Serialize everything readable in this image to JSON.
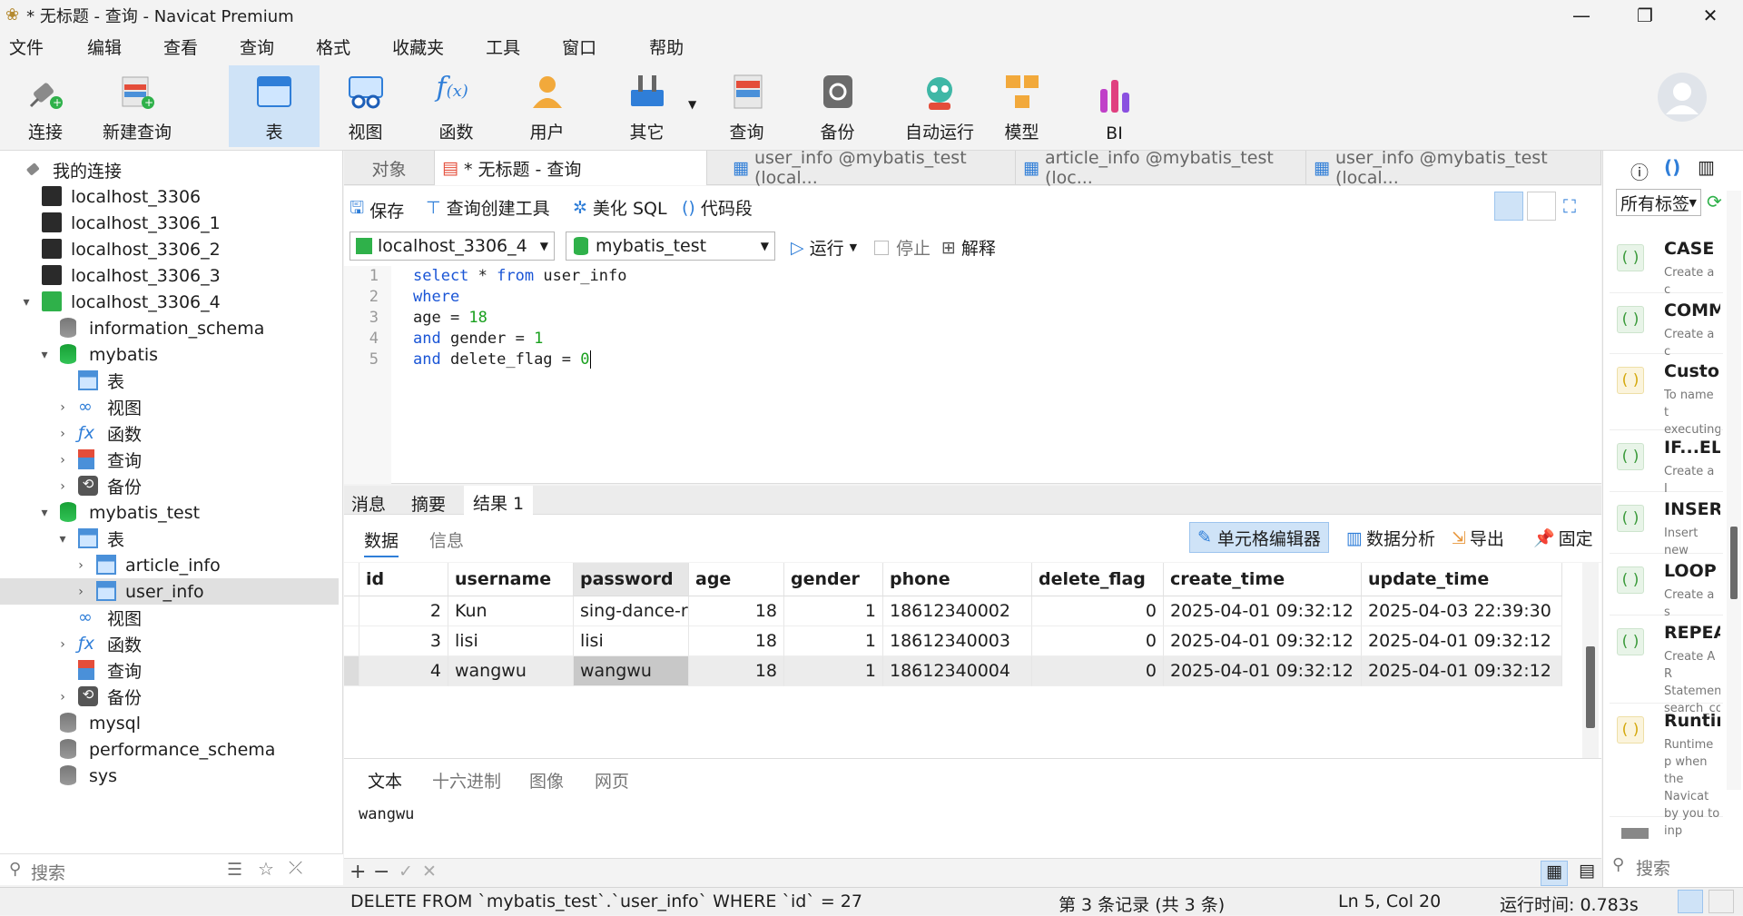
{
  "window": {
    "title": "* 无标题 - 查询 - Navicat Premium",
    "minimize": "—",
    "maximize": "❐",
    "close": "✕"
  },
  "menu": [
    "文件",
    "编辑",
    "查看",
    "查询",
    "格式",
    "收藏夹",
    "工具",
    "窗口",
    "帮助"
  ],
  "toolbar": [
    {
      "label": "连接",
      "icon": "plug-icon"
    },
    {
      "label": "新建查询",
      "icon": "new-query-icon"
    },
    {
      "label": "表",
      "icon": "table-icon",
      "active": true
    },
    {
      "label": "视图",
      "icon": "view-icon"
    },
    {
      "label": "函数",
      "icon": "function-icon"
    },
    {
      "label": "用户",
      "icon": "user-icon"
    },
    {
      "label": "其它",
      "icon": "tools-icon"
    },
    {
      "label": "查询",
      "icon": "query-icon"
    },
    {
      "label": "备份",
      "icon": "backup-icon"
    },
    {
      "label": "自动运行",
      "icon": "robot-icon"
    },
    {
      "label": "模型",
      "icon": "model-icon"
    },
    {
      "label": "BI",
      "icon": "bi-icon"
    }
  ],
  "sidebar": {
    "header": "我的连接",
    "items": [
      "localhost_3306",
      "localhost_3306_1",
      "localhost_3306_2",
      "localhost_3306_3",
      "localhost_3306_4",
      "information_schema",
      "mybatis",
      "表",
      "视图",
      "函数",
      "查询",
      "备份",
      "mybatis_test",
      "表",
      "article_info",
      "user_info",
      "视图",
      "函数",
      "查询",
      "备份",
      "mysql",
      "performance_schema",
      "sys"
    ],
    "search_placeholder": "搜索"
  },
  "tabs": [
    "对象",
    "* 无标题 - 查询",
    "user_info @mybatis_test (local...",
    "article_info @mybatis_test (loc...",
    "user_info @mybatis_test (local..."
  ],
  "query_toolbar": {
    "save": "保存",
    "builder": "查询创建工具",
    "beautify": "美化 SQL",
    "snippet": "代码段"
  },
  "selectors": {
    "connection": "localhost_3306_4",
    "database": "mybatis_test",
    "run": "运行",
    "stop": "停止",
    "explain": "解释"
  },
  "editor": {
    "lines": [
      "1",
      "2",
      "3",
      "4",
      "5"
    ]
  },
  "result_tabs": [
    "消息",
    "摘要",
    "结果 1"
  ],
  "result_toolbar": {
    "data": "数据",
    "info": "信息",
    "cell_editor": "单元格编辑器",
    "analysis": "数据分析",
    "export": "导出",
    "pin": "固定"
  },
  "grid": {
    "columns": [
      "id",
      "username",
      "password",
      "age",
      "gender",
      "phone",
      "delete_flag",
      "create_time",
      "update_time"
    ],
    "rows": [
      [
        "2",
        "Kun",
        "sing-dance-r",
        "18",
        "1",
        "18612340002",
        "0",
        "2025-04-01 09:32:12",
        "2025-04-03 22:39:30"
      ],
      [
        "3",
        "lisi",
        "lisi",
        "18",
        "1",
        "18612340003",
        "0",
        "2025-04-01 09:32:12",
        "2025-04-01 09:32:12"
      ],
      [
        "4",
        "wangwu",
        "wangwu",
        "18",
        "1",
        "18612340004",
        "0",
        "2025-04-01 09:32:12",
        "2025-04-01 09:32:12"
      ]
    ]
  },
  "view_tabs": [
    "文本",
    "十六进制",
    "图像",
    "网页"
  ],
  "cell_value": "wangwu",
  "bottom": {
    "add": "+",
    "remove": "−",
    "apply": "✓",
    "discard": "✕"
  },
  "status": {
    "sql": "DELETE FROM `mybatis_test`.`user_info` WHERE `id` = 27",
    "records": "第 3 条记录 (共 3 条)",
    "cursor": "Ln 5, Col 20",
    "time": "运行时间: 0.783s"
  },
  "right_panel": {
    "filter": "所有标签",
    "search": "搜索",
    "snippets": [
      {
        "title": "CASE",
        "desc": "Create a c"
      },
      {
        "title": "COMM",
        "desc": "Create a c"
      },
      {
        "title": "Custor",
        "desc": "To name t executing"
      },
      {
        "title": "IF...ELS",
        "desc": "Create a I"
      },
      {
        "title": "INSERT",
        "desc": "Insert new"
      },
      {
        "title": "LOOP",
        "desc": "Create a s"
      },
      {
        "title": "REPEA",
        "desc": "Create A R Statement search_co"
      },
      {
        "title": "Runtin",
        "desc": "Runtime p when the Navicat by you to inp"
      }
    ]
  }
}
